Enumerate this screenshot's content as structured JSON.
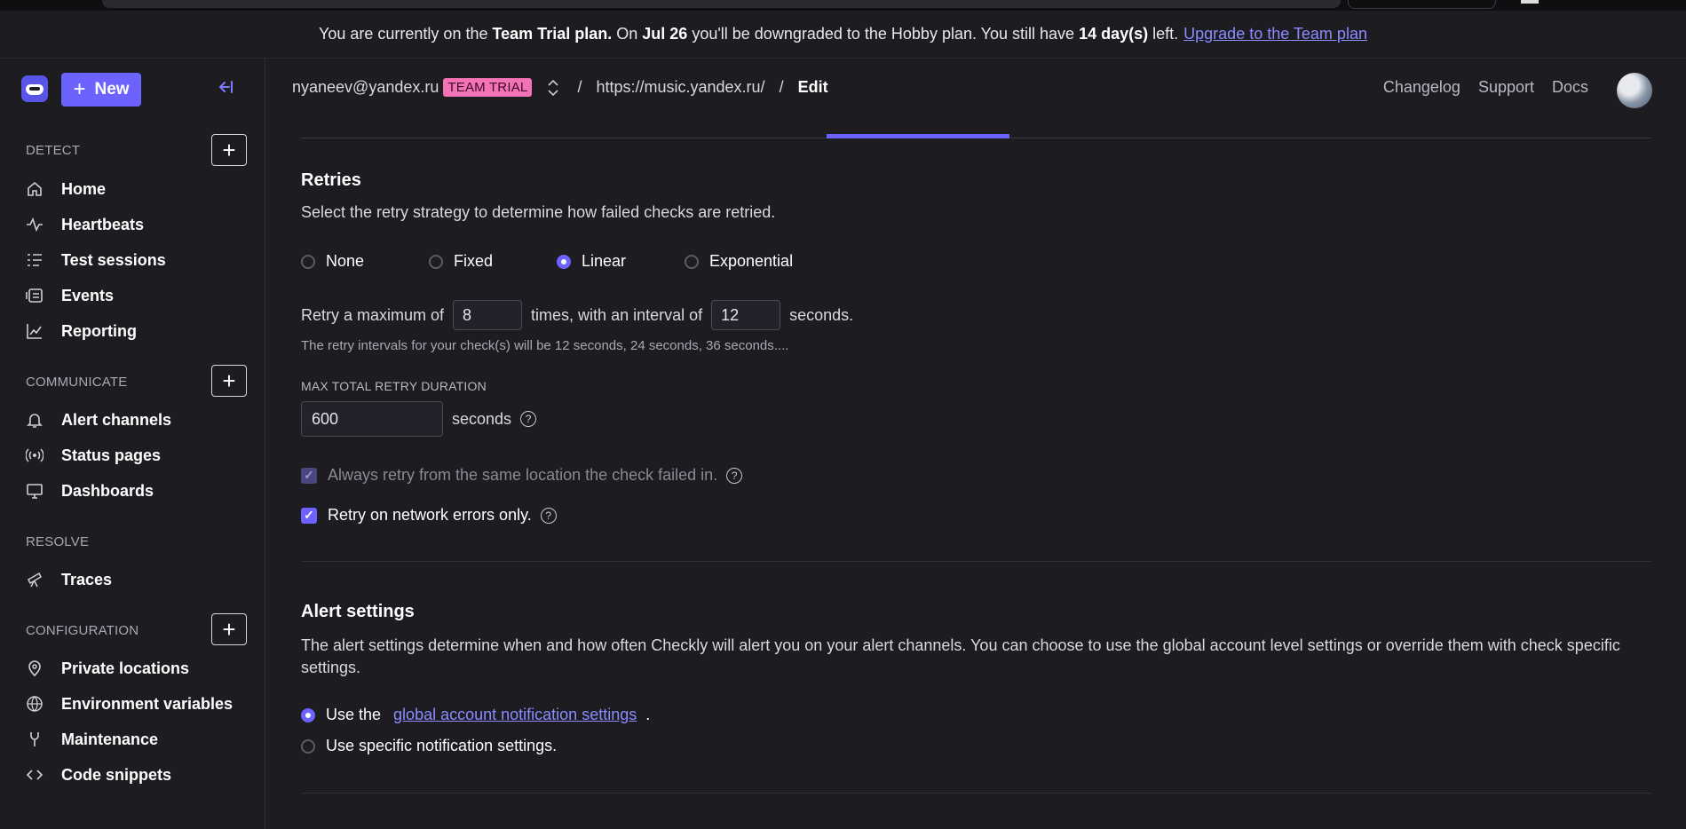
{
  "banner": {
    "prefix": "You are currently on the",
    "plan": "Team Trial plan.",
    "mid1": "On",
    "date": "Jul 26",
    "mid2": "you'll be downgraded to the Hobby plan. You still have",
    "days": "14 day(s)",
    "suffix": "left.",
    "link": "Upgrade to the Team plan"
  },
  "sidebar": {
    "new_label": "New",
    "sections": {
      "detect": "DETECT",
      "communicate": "COMMUNICATE",
      "resolve": "RESOLVE",
      "configuration": "CONFIGURATION"
    },
    "items": {
      "home": "Home",
      "heartbeats": "Heartbeats",
      "test_sessions": "Test sessions",
      "events": "Events",
      "reporting": "Reporting",
      "alert_channels": "Alert channels",
      "status_pages": "Status pages",
      "dashboards": "Dashboards",
      "traces": "Traces",
      "private_locations": "Private locations",
      "environment_variables": "Environment variables",
      "maintenance": "Maintenance",
      "code_snippets": "Code snippets"
    }
  },
  "header": {
    "account": "nyaneev@yandex.ru",
    "badge": "TEAM TRIAL",
    "sep": "/",
    "url": "https://music.yandex.ru/",
    "page": "Edit",
    "links": [
      "Changelog",
      "Support",
      "Docs"
    ]
  },
  "retries": {
    "title": "Retries",
    "description": "Select the retry strategy to determine how failed checks are retried.",
    "strategies": [
      "None",
      "Fixed",
      "Linear",
      "Exponential"
    ],
    "selected": "Linear",
    "row_prefix": "Retry a maximum of",
    "max_retries": "8",
    "row_mid": "times, with an interval of",
    "interval": "12",
    "row_suffix": "seconds.",
    "hint": "The retry intervals for your check(s) will be 12 seconds, 24 seconds, 36 seconds....",
    "max_duration_label": "MAX TOTAL RETRY DURATION",
    "max_duration": "600",
    "duration_unit": "seconds",
    "same_location": "Always retry from the same location the check failed in.",
    "network_only": "Retry on network errors only."
  },
  "alerts": {
    "title": "Alert settings",
    "description": "The alert settings determine when and how often Checkly will alert you on your alert channels. You can choose to use the global account level settings or override them with check specific settings.",
    "option1_prefix": "Use the",
    "option1_link": "global account notification settings",
    "option1_suffix": ".",
    "option2": "Use specific notification settings."
  },
  "colors": {
    "accent": "#6c63ff",
    "badge": "#f472b6",
    "link": "#8b8cff",
    "bg": "#1c1c21"
  }
}
